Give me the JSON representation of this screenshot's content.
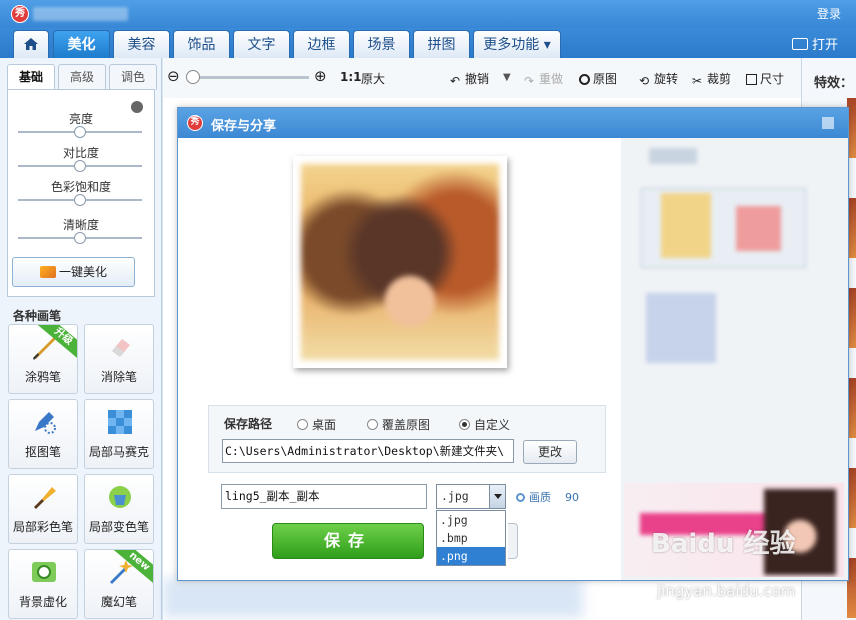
{
  "titlebar": {
    "login": "登录"
  },
  "tabs": [
    {
      "label": "美化"
    },
    {
      "label": "美容"
    },
    {
      "label": "饰品"
    },
    {
      "label": "文字"
    },
    {
      "label": "边框"
    },
    {
      "label": "场景"
    },
    {
      "label": "拼图"
    },
    {
      "label": "更多功能 ▾"
    }
  ],
  "open_label": "打开",
  "left": {
    "subtabs": [
      "基础",
      "高级",
      "调色"
    ],
    "sliders": [
      {
        "label": "亮度",
        "value": 0.5
      },
      {
        "label": "对比度",
        "value": 0.5
      },
      {
        "label": "色彩饱和度",
        "value": 0.5
      },
      {
        "label": "清晰度",
        "value": 0.5
      }
    ],
    "onekey": "一键美化",
    "brush_heading": "各种画笔",
    "tools": [
      {
        "label": "涂鸦笔",
        "badge": "升级"
      },
      {
        "label": "消除笔"
      },
      {
        "label": "抠图笔"
      },
      {
        "label": "局部马赛克"
      },
      {
        "label": "局部彩色笔"
      },
      {
        "label": "局部变色笔"
      },
      {
        "label": "背景虚化"
      },
      {
        "label": "魔幻笔",
        "badge": "new"
      }
    ]
  },
  "toolbar": {
    "ratio": "1:1",
    "original_size": "原大",
    "undo": "撤销",
    "redo": "重做",
    "original": "原图",
    "rotate": "旋转",
    "crop": "裁剪",
    "size": "尺寸"
  },
  "right": {
    "effects": "特效："
  },
  "dialog": {
    "title": "保存与分享",
    "path_label": "保存路径",
    "radios": [
      {
        "label": "桌面",
        "checked": false
      },
      {
        "label": "覆盖原图",
        "checked": false
      },
      {
        "label": "自定义",
        "checked": true
      }
    ],
    "path": "C:\\Users\\Administrator\\Desktop\\新建文件夹\\",
    "change": "更改",
    "filename": "ling5_副本_副本",
    "format": ".jpg",
    "format_options": [
      ".jpg",
      ".bmp",
      ".png"
    ],
    "selected_option": ".png",
    "quality_label": "画质",
    "quality_value": "90",
    "save": "保存"
  },
  "watermark": {
    "brand": "Baidu 经验",
    "url": "jingyan.baidu.com"
  },
  "colors": {
    "accent": "#3787d6",
    "save_green": "#2f9e1a",
    "selected_blue": "#2f7fd3"
  }
}
